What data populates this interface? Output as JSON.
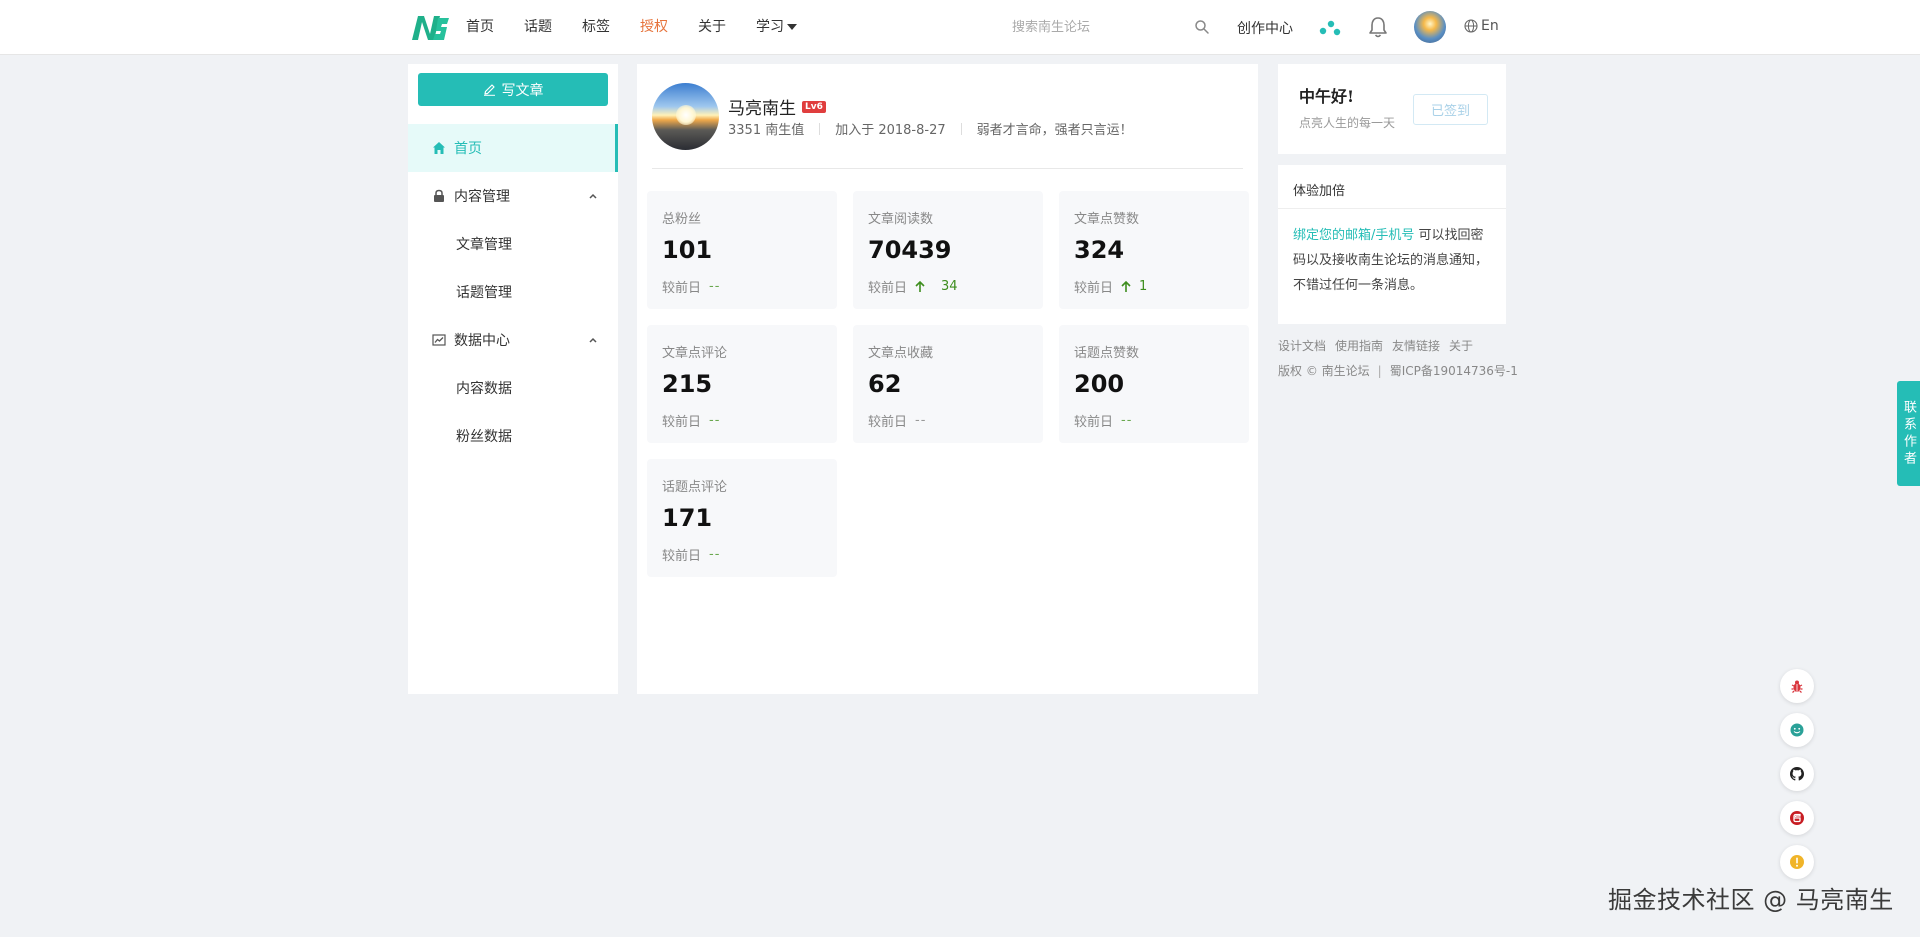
{
  "header": {
    "nav": [
      {
        "label": "首页",
        "active": false
      },
      {
        "label": "话题",
        "active": false
      },
      {
        "label": "标签",
        "active": false
      },
      {
        "label": "授权",
        "active": true
      },
      {
        "label": "关于",
        "active": false
      },
      {
        "label": "学习",
        "active": false
      }
    ],
    "search_placeholder": "搜索南生论坛",
    "create_center": "创作中心",
    "lang": "En"
  },
  "sidebar": {
    "write_button": "写文章",
    "items": [
      {
        "label": "首页"
      },
      {
        "label": "内容管理"
      },
      {
        "label": "文章管理"
      },
      {
        "label": "话题管理"
      },
      {
        "label": "数据中心"
      },
      {
        "label": "内容数据"
      },
      {
        "label": "粉丝数据"
      }
    ]
  },
  "profile": {
    "name": "马亮南生",
    "level": "Lv6",
    "score": "3351 南生值",
    "joined": "加入于 2018-8-27",
    "motto": "弱者才言命，强者只言运！"
  },
  "stats": [
    {
      "label": "总粉丝",
      "value": "101",
      "cmp_label": "较前日",
      "cmp": "--",
      "up": false
    },
    {
      "label": "文章阅读数",
      "value": "70439",
      "cmp_label": "较前日",
      "cmp": "34",
      "up": true
    },
    {
      "label": "文章点赞数",
      "value": "324",
      "cmp_label": "较前日",
      "cmp": "1",
      "up": true
    },
    {
      "label": "文章点评论",
      "value": "215",
      "cmp_label": "较前日",
      "cmp": "--",
      "up": false
    },
    {
      "label": "文章点收藏",
      "value": "62",
      "cmp_label": "较前日",
      "cmp": "--",
      "up": false
    },
    {
      "label": "话题点赞数",
      "value": "200",
      "cmp_label": "较前日",
      "cmp": "--",
      "up": false
    },
    {
      "label": "话题点评论",
      "value": "171",
      "cmp_label": "较前日",
      "cmp": "--",
      "up": false
    }
  ],
  "greeting": {
    "title": "中午好!",
    "subtitle": "点亮人生的每一天",
    "checkin": "已签到"
  },
  "experience": {
    "title": "体验加倍",
    "link": "绑定您的邮箱/手机号",
    "text": " 可以找回密码以及接收南生论坛的消息通知，不错过任何一条消息。"
  },
  "footer": {
    "links": [
      "设计文档",
      "使用指南",
      "友情链接",
      "关于"
    ],
    "copyright": "版权 © 南生论坛",
    "icp": "蜀ICP备19014736号-1"
  },
  "contact_tab": "联系作者",
  "watermark": "掘金技术社区 @ 马亮南生",
  "colors": {
    "accent": "#25bdb6",
    "nav_active": "#e6733b",
    "up": "#3e8e1e"
  }
}
